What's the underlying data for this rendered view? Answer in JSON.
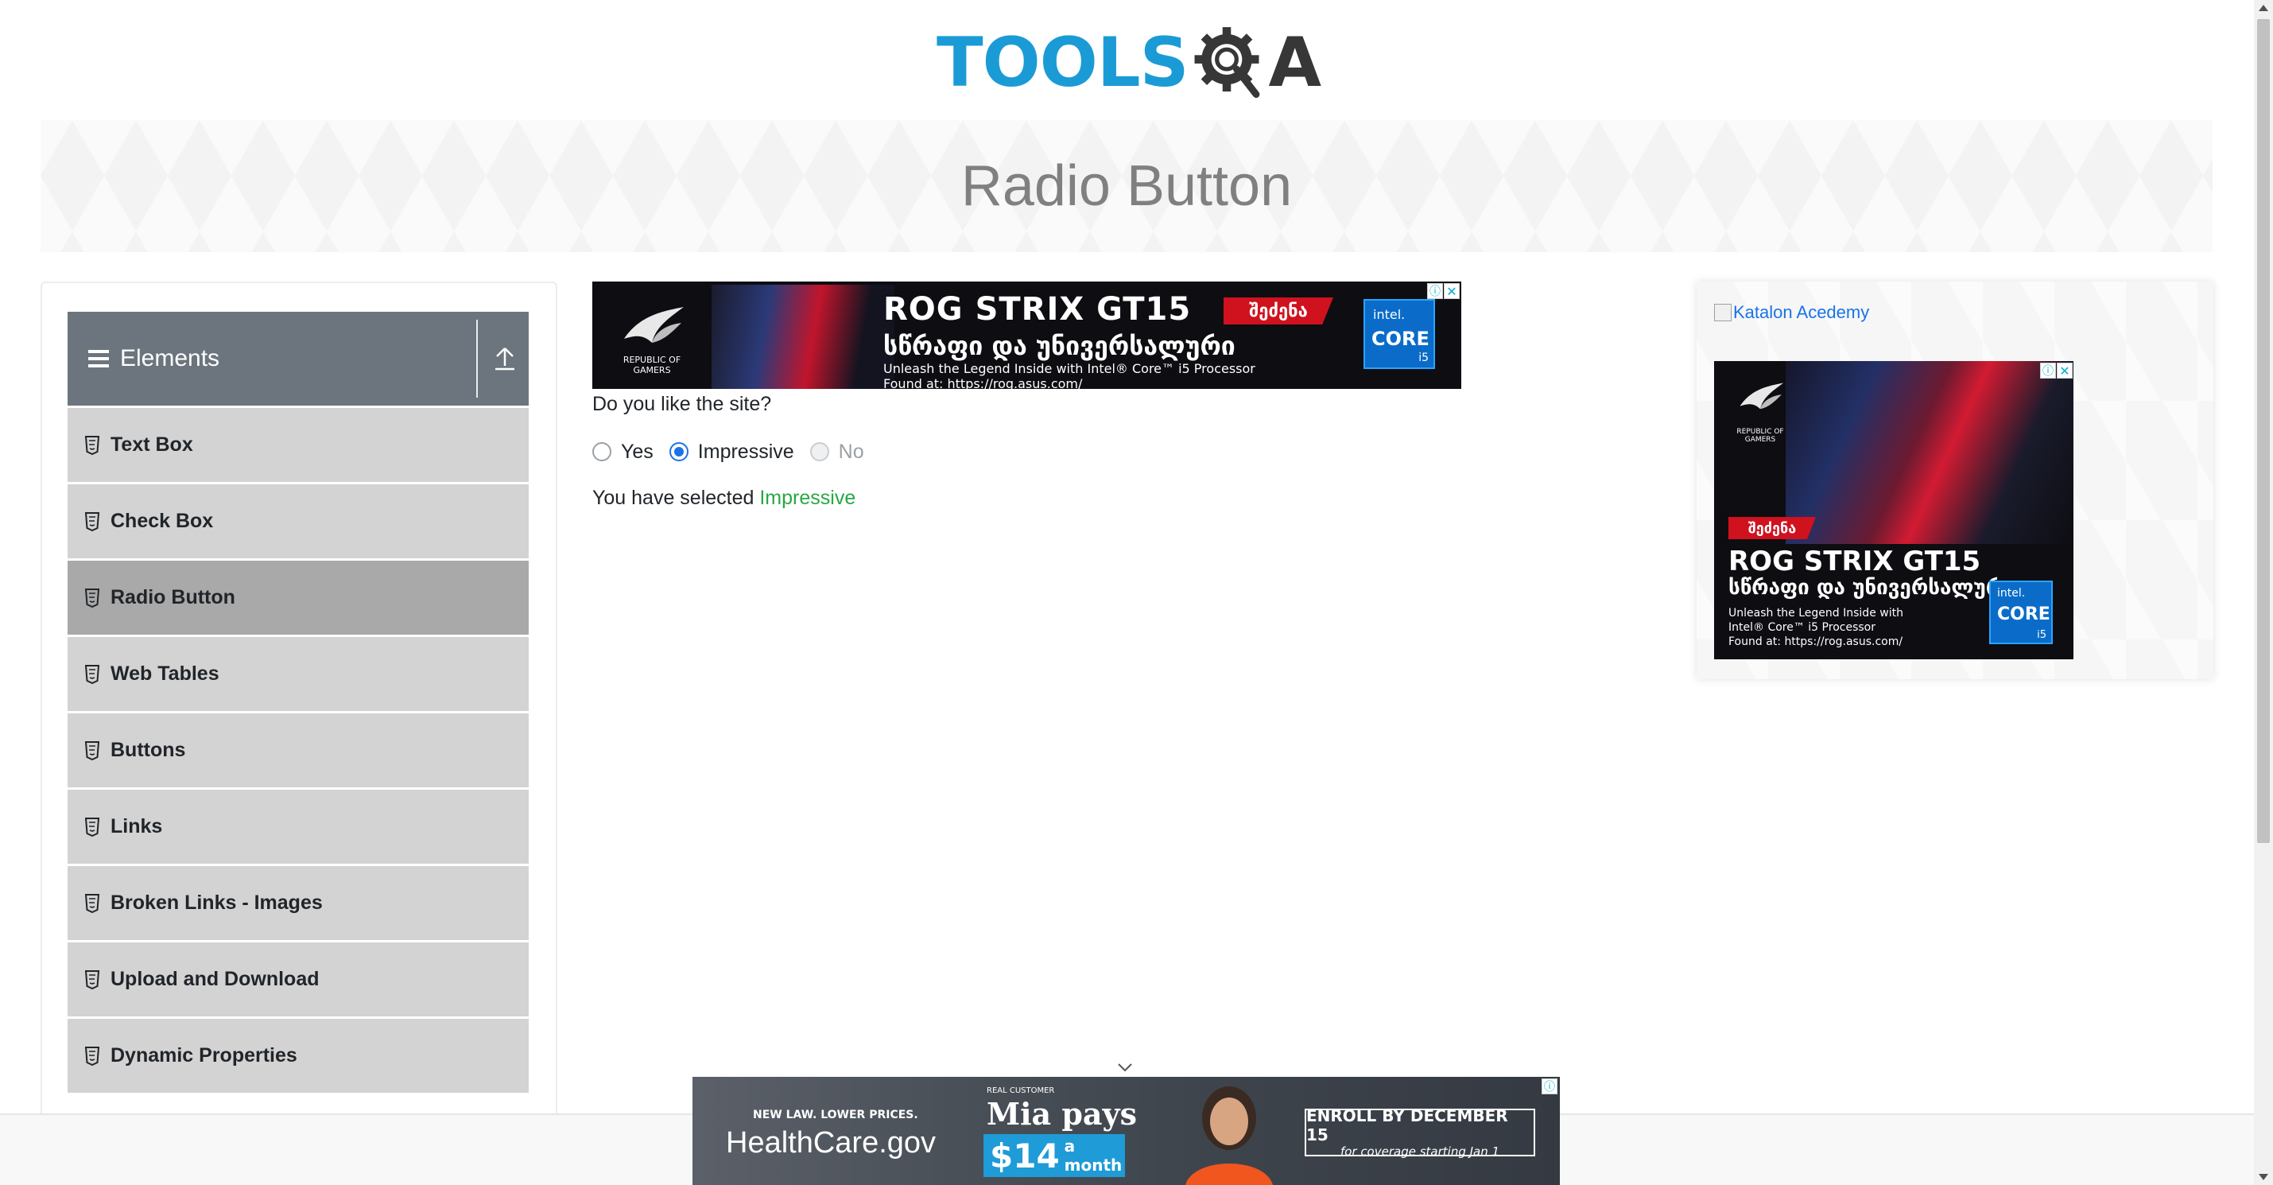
{
  "header": {
    "logo_text": "TOOLS",
    "logo_letter": "A"
  },
  "banner": {
    "title": "Radio Button"
  },
  "sidebar": {
    "group_title": "Elements",
    "items": [
      {
        "label": "Text Box"
      },
      {
        "label": "Check Box"
      },
      {
        "label": "Radio Button",
        "active": true
      },
      {
        "label": "Web Tables"
      },
      {
        "label": "Buttons"
      },
      {
        "label": "Links"
      },
      {
        "label": "Broken Links - Images"
      },
      {
        "label": "Upload and Download"
      },
      {
        "label": "Dynamic Properties"
      }
    ]
  },
  "top_ad": {
    "headline": "ROG STRIX GT15",
    "cta": "შეძენა",
    "geo": "სწრაფი და უნივერსალური",
    "sub_line1": "Unleash the Legend Inside with Intel® Core™ i5 Processor",
    "sub_line2": "Found at: https://rog.asus.com/",
    "rog_caption": "REPUBLIC OF GAMERS",
    "intel_brand": "intel.",
    "intel_core": "CORE",
    "intel_gen": "i5"
  },
  "main": {
    "question": "Do you like the site?",
    "options": [
      {
        "label": "Yes",
        "checked": false,
        "disabled": false
      },
      {
        "label": "Impressive",
        "checked": true,
        "disabled": false
      },
      {
        "label": "No",
        "checked": false,
        "disabled": true
      }
    ],
    "result_prefix": "You have selected ",
    "result_value": "Impressive"
  },
  "right_panel": {
    "link_text": "Katalon Acedemy",
    "ad": {
      "cta": "შეძენა",
      "headline": "ROG STRIX GT15",
      "geo": "სწრაფი და უნივერსალური",
      "sub_line1": "Unleash the Legend Inside with",
      "sub_line2": "Intel® Core™ i5 Processor",
      "sub_line3": "Found at: https://rog.asus.com/",
      "rog_caption": "REPUBLIC OF GAMERS",
      "intel_brand": "intel.",
      "intel_core": "CORE",
      "intel_gen": "i5"
    }
  },
  "bottom_ad": {
    "small_line": "NEW LAW. LOWER PRICES.",
    "brand": "HealthCare.gov",
    "real_customer": "REAL CUSTOMER",
    "name_line": "Mia pays",
    "price": "$14",
    "per": "a month",
    "enroll_line1": "ENROLL BY DECEMBER 15",
    "enroll_line2": "for coverage starting Jan 1"
  },
  "badges": {
    "info": "ⓘ",
    "close": "✕"
  },
  "colors": {
    "logo_blue": "#1b9bd6",
    "logo_dark": "#373737",
    "sidebar_header": "#6c757d",
    "menu_item": "#d3d3d3",
    "menu_item_active": "#a9a9a9",
    "result_green": "#28a745",
    "radio_blue": "#1a73e8"
  },
  "icons": {
    "menu": "hamburger-icon",
    "collapse": "upload-icon",
    "item": "html5-shield-icon",
    "expand": "chevron-down-icon"
  }
}
